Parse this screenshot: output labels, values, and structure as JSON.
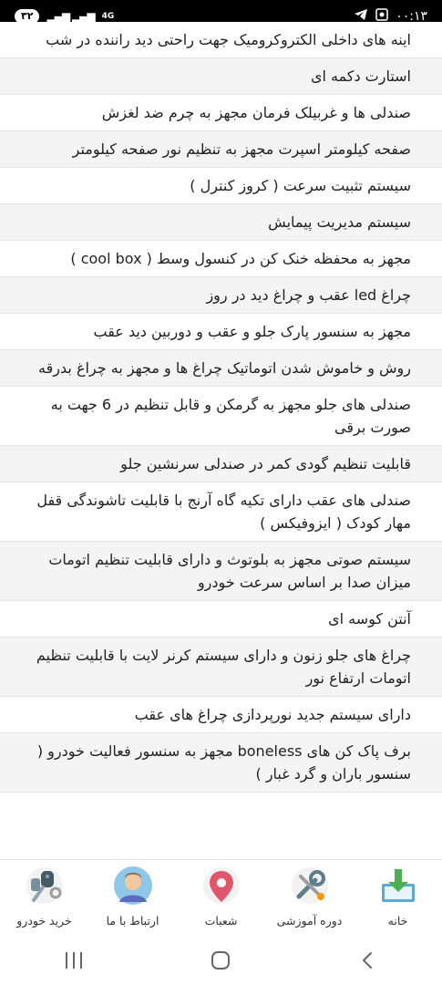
{
  "status_bar": {
    "time": "۰۰:۱۳",
    "battery": "۳۲",
    "network": "4G"
  },
  "features": [
    "اینه های داخلی الکتروکرومیک جهت راحتی دید راننده در شب",
    "استارت دکمه ای",
    "صندلی ها و غربیلک فرمان مجهز به چرم ضد لغزش",
    "صفحه کیلومتر اسپرت مجهز به تنظیم نور صفحه کیلومتر",
    "سیستم تثبیت سرعت ( کروز کنترل )",
    "سیستم مدیریت پیمایش",
    "مجهز به محفظه خنک کن در کنسول وسط ( cool box )",
    "چراغ led عقب و چراغ دید در روز",
    "مجهز به سنسور پارک جلو و عقب و دوربین دید عقب",
    "روش و خاموش شدن اتوماتیک چراغ ها و مجهز به چراغ بدرقه",
    "صندلی های جلو مجهز به گرمکن و قابل تنظیم در 6 جهت به صورت برقی",
    "قابلیت تنظیم گودی کمر در صندلی سرنشین جلو",
    "صندلی های عقب دارای تکیه گاه آرنج با قابلیت تاشوندگی قفل مهار کودک ( ایزوفیکس )",
    "سیستم صوتی مجهز به بلوتوث و دارای قابلیت تنظیم اتومات میزان صدا بر اساس سرعت خودرو",
    "آنتن کوسه ای",
    "چراغ های جلو زنون و دارای سیستم کرنر لایت با قابلیت تنظیم اتومات ارتفاع نور",
    "دارای سیستم جدید نورپردازی چراغ های عقب",
    "برف پاک کن های boneless مجهز به سنسور فعالیت خودرو ( سنسور باران و گرد غبار )"
  ],
  "bottom_nav": {
    "items": [
      {
        "label": "خانه",
        "icon": "home-download-icon"
      },
      {
        "label": "دوره آموزشی",
        "icon": "training-tools-icon"
      },
      {
        "label": "شعبات",
        "icon": "location-pin-icon"
      },
      {
        "label": "ارتباط با ما",
        "icon": "support-avatar-icon"
      },
      {
        "label": "خرید خودرو",
        "icon": "car-keys-icon"
      }
    ]
  }
}
